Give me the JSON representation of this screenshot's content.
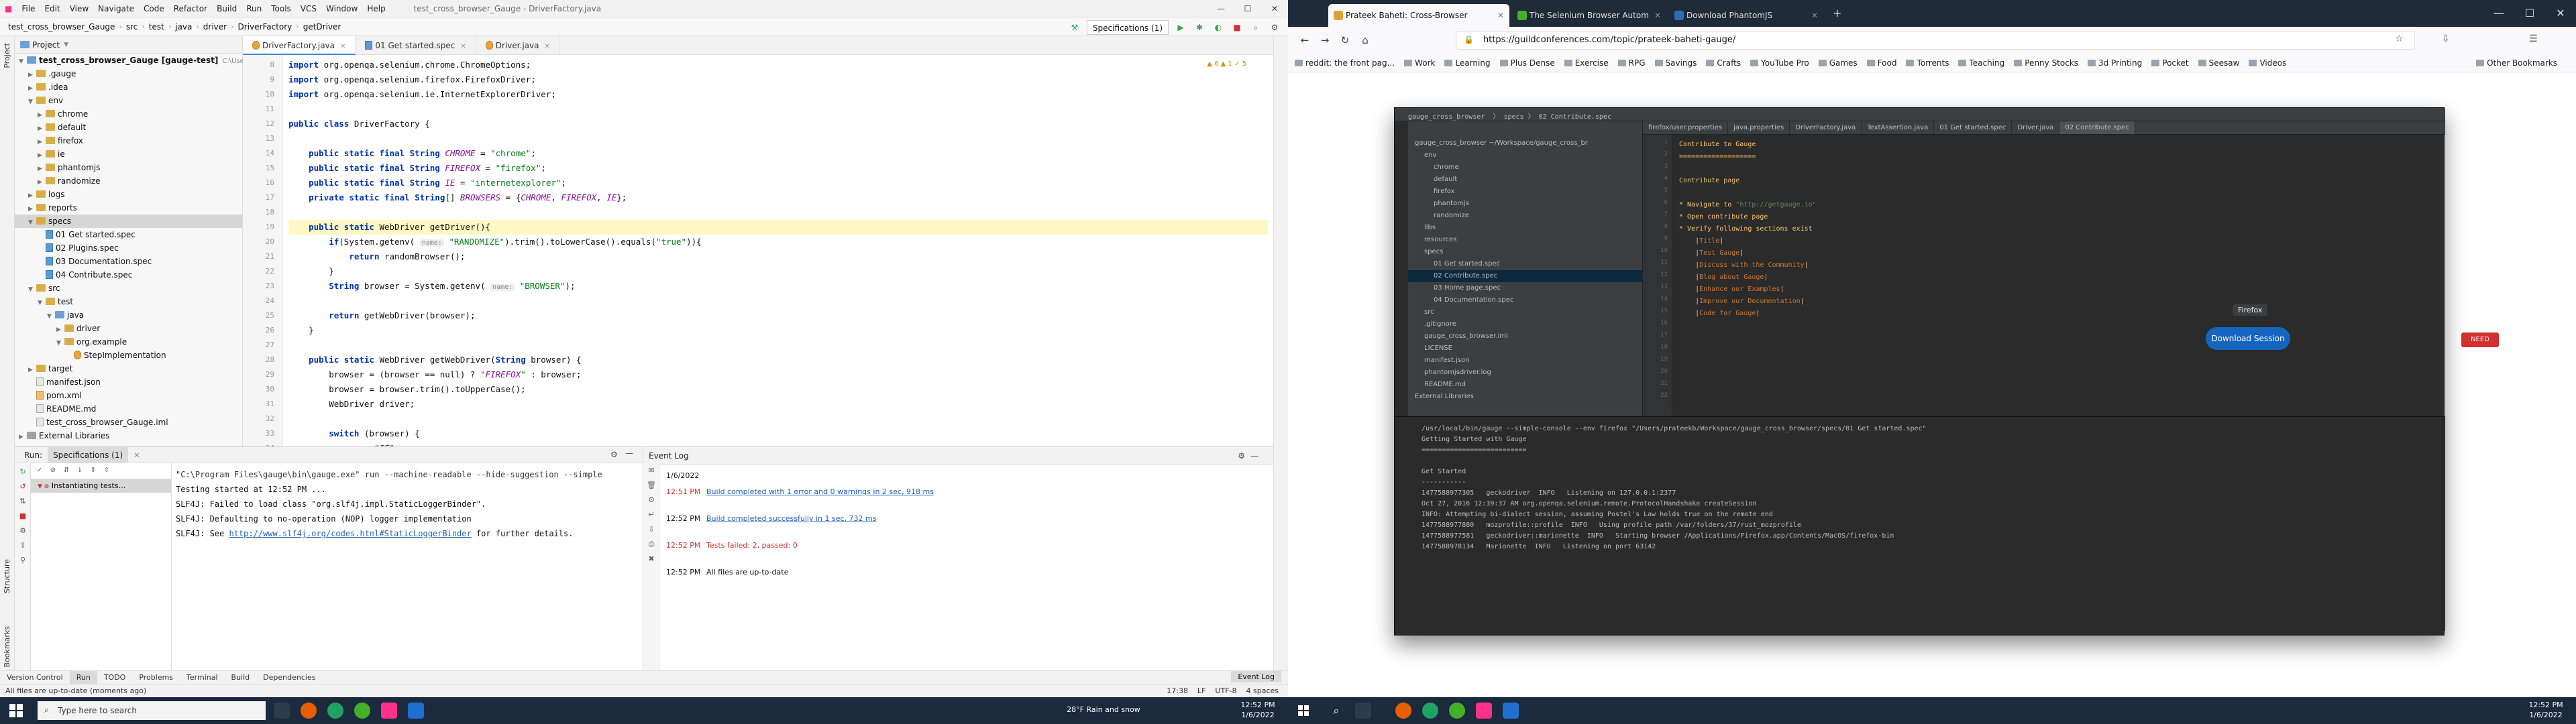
{
  "ide": {
    "menubar": {
      "items": [
        "File",
        "Edit",
        "View",
        "Navigate",
        "Code",
        "Refactor",
        "Build",
        "Run",
        "Tools",
        "VCS",
        "Window",
        "Help"
      ],
      "project_title": "test_cross_browser_Gauge - DriverFactory.java"
    },
    "breadcrumbs": [
      "test_cross_browser_Gauge",
      "src",
      "test",
      "java",
      "driver",
      "DriverFactory",
      "getDriver"
    ],
    "run_config": "Specifications (1)",
    "project_panel": {
      "title": "Project",
      "items": [
        {
          "label": "test_cross_browser_Gauge [gauge-test]",
          "note": "C:\\Users\\Pratee\\",
          "depth": 0,
          "kind": "folder-blue",
          "open": true
        },
        {
          "label": ".gauge",
          "depth": 1,
          "kind": "folder",
          "open": false
        },
        {
          "label": ".idea",
          "depth": 1,
          "kind": "folder",
          "open": false
        },
        {
          "label": "env",
          "depth": 1,
          "kind": "folder",
          "open": true
        },
        {
          "label": "chrome",
          "depth": 2,
          "kind": "folder",
          "open": false
        },
        {
          "label": "default",
          "depth": 2,
          "kind": "folder",
          "open": false
        },
        {
          "label": "firefox",
          "depth": 2,
          "kind": "folder",
          "open": false
        },
        {
          "label": "ie",
          "depth": 2,
          "kind": "folder",
          "open": false
        },
        {
          "label": "phantomjs",
          "depth": 2,
          "kind": "folder",
          "open": false
        },
        {
          "label": "randomize",
          "depth": 2,
          "kind": "folder",
          "open": false
        },
        {
          "label": "logs",
          "depth": 1,
          "kind": "folder",
          "open": false
        },
        {
          "label": "reports",
          "depth": 1,
          "kind": "folder",
          "open": false
        },
        {
          "label": "specs",
          "depth": 1,
          "kind": "folder",
          "open": true,
          "selected": true
        },
        {
          "label": "01 Get started.spec",
          "depth": 2,
          "kind": "spec"
        },
        {
          "label": "02 Plugins.spec",
          "depth": 2,
          "kind": "spec"
        },
        {
          "label": "03 Documentation.spec",
          "depth": 2,
          "kind": "spec"
        },
        {
          "label": "04 Contribute.spec",
          "depth": 2,
          "kind": "spec"
        },
        {
          "label": "src",
          "depth": 1,
          "kind": "folder",
          "open": true
        },
        {
          "label": "test",
          "depth": 2,
          "kind": "folder",
          "open": true
        },
        {
          "label": "java",
          "depth": 3,
          "kind": "folder-blue",
          "open": true
        },
        {
          "label": "driver",
          "depth": 4,
          "kind": "folder",
          "open": false
        },
        {
          "label": "org.example",
          "depth": 4,
          "kind": "folder",
          "open": true
        },
        {
          "label": "StepImplementation",
          "depth": 5,
          "kind": "java"
        },
        {
          "label": "target",
          "depth": 1,
          "kind": "folder",
          "open": false
        },
        {
          "label": "manifest.json",
          "depth": 1,
          "kind": "file"
        },
        {
          "label": "pom.xml",
          "depth": 1,
          "kind": "xml"
        },
        {
          "label": "README.md",
          "depth": 1,
          "kind": "file"
        },
        {
          "label": "test_cross_browser_Gauge.iml",
          "depth": 1,
          "kind": "file"
        },
        {
          "label": "External Libraries",
          "depth": 0,
          "kind": "folder-gray",
          "open": false
        }
      ]
    },
    "editor_tabs": [
      "DriverFactory.java",
      "01 Get started.spec",
      "Driver.java"
    ],
    "code_lines": [
      {
        "n": "8",
        "text": "import org.openqa.selenium.chrome.ChromeOptions;"
      },
      {
        "n": "9",
        "text": "import org.openqa.selenium.firefox.FirefoxDriver;"
      },
      {
        "n": "10",
        "text": "import org.openqa.selenium.ie.InternetExplorerDriver;"
      },
      {
        "n": "11",
        "text": ""
      },
      {
        "n": "12",
        "text": "public class DriverFactory {"
      },
      {
        "n": "13",
        "text": ""
      },
      {
        "n": "14",
        "text": "    public static final String CHROME = \"chrome\";"
      },
      {
        "n": "15",
        "text": "    public static final String FIREFOX = \"firefox\";"
      },
      {
        "n": "16",
        "text": "    public static final String IE = \"internetexplorer\";"
      },
      {
        "n": "17",
        "text": "    private static final String[] BROWSERS = {CHROME, FIREFOX, IE};"
      },
      {
        "n": "18",
        "text": ""
      },
      {
        "n": "19",
        "text": "    public static WebDriver getDriver(){"
      },
      {
        "n": "20",
        "text": "        if(System.getenv( name: \"RANDOMIZE\").trim().toLowerCase().equals(\"true\")){"
      },
      {
        "n": "21",
        "text": "            return randomBrowser();"
      },
      {
        "n": "22",
        "text": "        }"
      },
      {
        "n": "23",
        "text": "        String browser = System.getenv( name: \"BROWSER\");"
      },
      {
        "n": "24",
        "text": ""
      },
      {
        "n": "25",
        "text": "        return getWebDriver(browser);"
      },
      {
        "n": "26",
        "text": "    }"
      },
      {
        "n": "27",
        "text": ""
      },
      {
        "n": "28",
        "text": "    public static WebDriver getWebDriver(String browser) {"
      },
      {
        "n": "29",
        "text": "        browser = (browser == null) ? \"FIREFOX\" : browser;"
      },
      {
        "n": "30",
        "text": "        browser = browser.trim().toUpperCase();"
      },
      {
        "n": "31",
        "text": "        WebDriver driver;"
      },
      {
        "n": "32",
        "text": ""
      },
      {
        "n": "33",
        "text": "        switch (browser) {"
      },
      {
        "n": "34",
        "text": "            case \"IE\":"
      }
    ],
    "run_panel": {
      "tab_run": "Run:",
      "tab_config": "Specifications (1)",
      "tree_item": "Instantiating tests...",
      "console": [
        "\"C:\\Program Files\\gauge\\bin\\gauge.exe\" run --machine-readable --hide-suggestion --simple",
        "Testing started at 12:52 PM ...",
        "SLF4J: Failed to load class \"org.slf4j.impl.StaticLoggerBinder\".",
        "SLF4J: Defaulting to no-operation (NOP) logger implementation",
        "SLF4J: See http://www.slf4j.org/codes.html#StaticLoggerBinder for further details."
      ]
    },
    "event_log": {
      "title": "Event Log",
      "date": "1/6/2022",
      "events": [
        {
          "time": "12:51 PM",
          "text": "Build completed with 1 error and 0 warnings in 2 sec, 918 ms",
          "style": "error-link"
        },
        {
          "time": "12:52 PM",
          "text": "Build completed successfully in 1 sec, 732 ms",
          "style": "link"
        },
        {
          "time": "12:52 PM",
          "text": "Tests failed: 2, passed: 0",
          "style": "error"
        },
        {
          "time": "12:52 PM",
          "text": "All files are up-to-date",
          "style": "plain"
        }
      ]
    },
    "bottom_tabs": [
      "Version Control",
      "Run",
      "TODO",
      "Problems",
      "Terminal",
      "Build",
      "Dependencies"
    ],
    "event_log_tab": "Event Log",
    "status_text": "All files are up-to-date (moments ago)",
    "status_right": [
      "17:38",
      "LF",
      "UTF-8",
      "4 spaces"
    ],
    "left_tools": [
      "Project",
      "Structure",
      "Bookmarks"
    ]
  },
  "taskbar": {
    "search_placeholder": "Type here to search",
    "weather": "28°F  Rain and snow",
    "time": "12:52 PM",
    "date": "1/6/2022"
  },
  "browser": {
    "tabs": [
      "Prateek Baheti: Cross-Browser",
      "The Selenium Browser Autom",
      "Download PhantomJS"
    ],
    "url": "https://guildconferences.com/topic/prateek-baheti-gauge/",
    "bookmarks": [
      "reddit: the front pag...",
      "Work",
      "Learning",
      "Plus Dense",
      "Exercise",
      "RPG",
      "Savings",
      "Crafts",
      "YouTube Pro",
      "Games",
      "Food",
      "Torrents",
      "Teaching",
      "Penny Stocks",
      "3d Printing",
      "Pocket",
      "Seesaw",
      "Videos"
    ],
    "bookmarks_other": "Other Bookmarks",
    "download_label": "Download Session",
    "need_help": "NEED HELP?",
    "tooltip": "Firefox"
  }
}
